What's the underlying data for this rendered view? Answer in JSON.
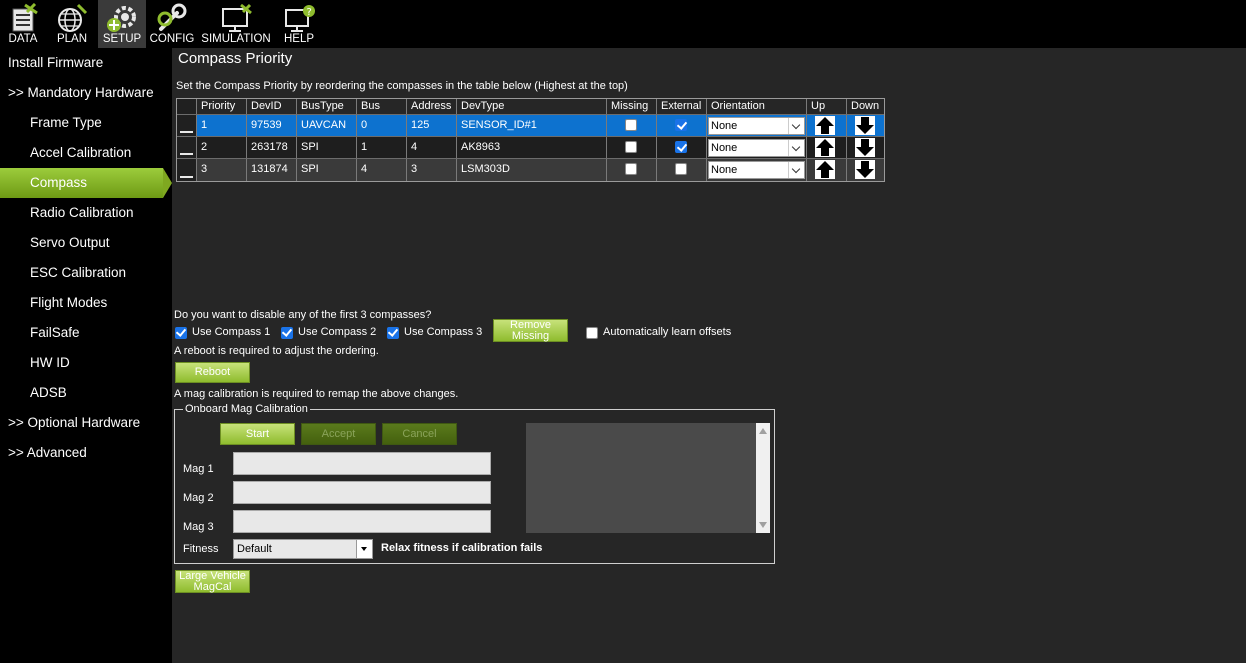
{
  "menu": [
    {
      "label": "DATA",
      "icon": "data-icon"
    },
    {
      "label": "PLAN",
      "icon": "globe-icon"
    },
    {
      "label": "SETUP",
      "icon": "gear-icon",
      "active": true
    },
    {
      "label": "CONFIG",
      "icon": "wrench-icon"
    },
    {
      "label": "SIMULATION",
      "icon": "monitor-icon"
    },
    {
      "label": "HELP",
      "icon": "help-icon"
    }
  ],
  "sidebar": {
    "items": [
      {
        "label": "Install Firmware"
      },
      {
        "label": ">> Mandatory Hardware"
      },
      {
        "label": "Frame Type"
      },
      {
        "label": "Accel Calibration"
      },
      {
        "label": "Compass",
        "active": true
      },
      {
        "label": "Radio Calibration"
      },
      {
        "label": "Servo Output"
      },
      {
        "label": "ESC Calibration"
      },
      {
        "label": "Flight Modes"
      },
      {
        "label": "FailSafe"
      },
      {
        "label": "HW ID"
      },
      {
        "label": "ADSB"
      },
      {
        "label": ">> Optional Hardware"
      },
      {
        "label": ">> Advanced"
      }
    ]
  },
  "page": {
    "title": "Compass Priority",
    "hint": "Set the Compass Priority by reordering the compasses in the table below (Highest at the top)"
  },
  "table": {
    "headers": [
      "Priority",
      "DevID",
      "BusType",
      "Bus",
      "Address",
      "DevType",
      "Missing",
      "External",
      "Orientation",
      "Up",
      "Down"
    ],
    "rows": [
      {
        "priority": "1",
        "devid": "97539",
        "bustype": "UAVCAN",
        "bus": "0",
        "address": "125",
        "devtype": "SENSOR_ID#1",
        "missing": false,
        "external": true,
        "orientation": "None"
      },
      {
        "priority": "2",
        "devid": "263178",
        "bustype": "SPI",
        "bus": "1",
        "address": "4",
        "devtype": "AK8963",
        "missing": false,
        "external": true,
        "orientation": "None"
      },
      {
        "priority": "3",
        "devid": "131874",
        "bustype": "SPI",
        "bus": "4",
        "address": "3",
        "devtype": "LSM303D",
        "missing": false,
        "external": false,
        "orientation": "None"
      }
    ]
  },
  "disable": {
    "question": "Do you want to disable any of the first 3 compasses?",
    "use1": "Use Compass 1",
    "use2": "Use Compass 2",
    "use3": "Use Compass 3",
    "remove_missing_line1": "Remove",
    "remove_missing_line2": "Missing",
    "auto_learn": "Automatically learn offsets",
    "reboot_note": "A reboot is required to adjust the ordering.",
    "reboot": "Reboot",
    "mag_note": "A mag calibration is required to remap the above changes."
  },
  "onboard": {
    "title": "Onboard Mag Calibration",
    "start": "Start",
    "accept": "Accept",
    "cancel": "Cancel",
    "mag1": "Mag 1",
    "mag2": "Mag 2",
    "mag3": "Mag 3",
    "fitness_label": "Fitness",
    "fitness_value": "Default",
    "relax": "Relax fitness if calibration fails"
  },
  "large_vehicle_line1": "Large Vehicle",
  "large_vehicle_line2": "MagCal",
  "colors": {
    "accent_green": "#8fbc2e",
    "selection_blue": "#0d72cf",
    "check_blue": "#1a73e8"
  }
}
